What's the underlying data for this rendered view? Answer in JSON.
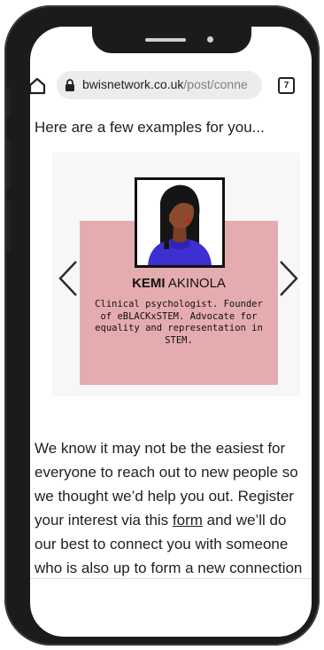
{
  "browser": {
    "url_domain": "bwisnetwork.co.uk",
    "url_path": "/post/conne",
    "tab_count": "7"
  },
  "content": {
    "intro": "Here are a few examples for you...",
    "profile": {
      "first_name": "KEMI",
      "last_name": "AKINOLA",
      "bio_lines": [
        "Clinical psychologist. Founder",
        "of eBLACKxSTEM. Advocate for",
        "equality and representation in",
        "STEM."
      ]
    },
    "paragraph": {
      "line1": "We know it may not be the easiest for",
      "line2": "everyone to reach out to new people so",
      "line3": "we thought we’d help you out. Register",
      "line4_before": "your interest via this ",
      "form_link": "form",
      "line4_after": " and we’ll do",
      "line5": "our best to connect you with someone",
      "line6": "who is also up to form a new connection"
    }
  },
  "colors": {
    "card_pink": "#e5acb0",
    "sweater_blue": "#3d2fd0",
    "frame": "#1b1b1b"
  }
}
